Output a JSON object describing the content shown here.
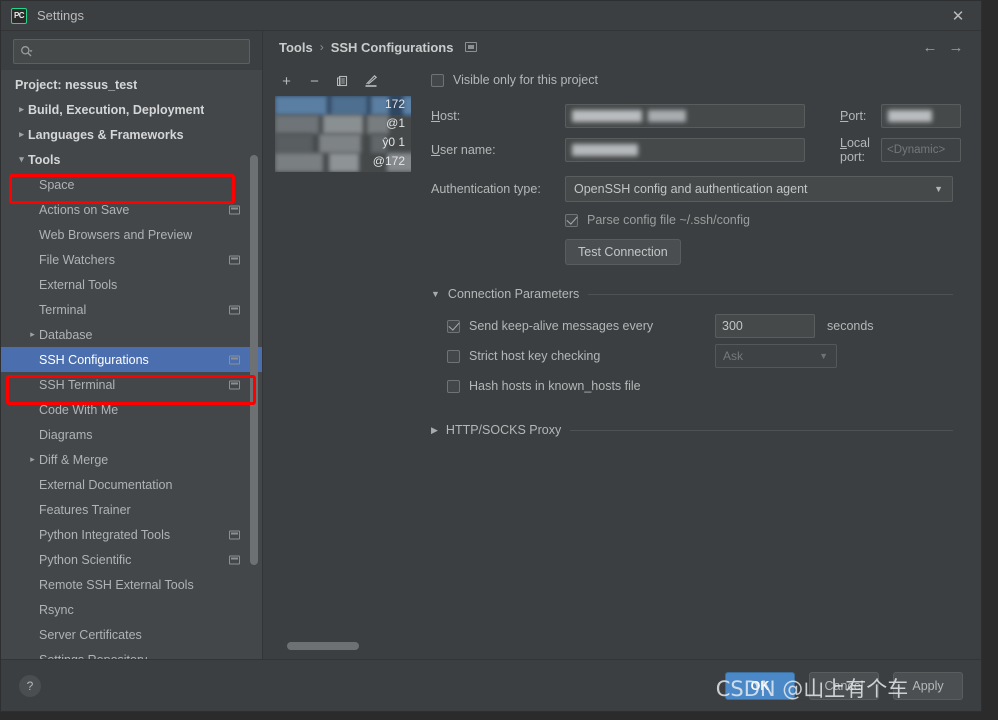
{
  "window": {
    "app_icon_label": "PC",
    "title": "Settings",
    "close_icon": "close-icon"
  },
  "sidebar": {
    "search": {
      "placeholder": "",
      "value": "",
      "icon": "search-icon"
    },
    "items": [
      {
        "label": "Project: nessus_test",
        "arrow": "",
        "bold": true,
        "indent": 1,
        "badge": false,
        "selected": false
      },
      {
        "label": "Build, Execution, Deployment",
        "arrow": "›",
        "bold": true,
        "indent": 1,
        "badge": false,
        "selected": false
      },
      {
        "label": "Languages & Frameworks",
        "arrow": "›",
        "bold": true,
        "indent": 1,
        "badge": false,
        "selected": false
      },
      {
        "label": "Tools",
        "arrow": "⌄",
        "bold": true,
        "indent": 1,
        "badge": false,
        "selected": false
      },
      {
        "label": "Space",
        "arrow": "",
        "bold": false,
        "indent": 2,
        "badge": false,
        "selected": false
      },
      {
        "label": "Actions on Save",
        "arrow": "",
        "bold": false,
        "indent": 2,
        "badge": true,
        "selected": false
      },
      {
        "label": "Web Browsers and Preview",
        "arrow": "",
        "bold": false,
        "indent": 2,
        "badge": false,
        "selected": false
      },
      {
        "label": "File Watchers",
        "arrow": "",
        "bold": false,
        "indent": 2,
        "badge": true,
        "selected": false
      },
      {
        "label": "External Tools",
        "arrow": "",
        "bold": false,
        "indent": 2,
        "badge": false,
        "selected": false
      },
      {
        "label": "Terminal",
        "arrow": "",
        "bold": false,
        "indent": 2,
        "badge": true,
        "selected": false
      },
      {
        "label": "Database",
        "arrow": "›",
        "bold": false,
        "indent": 2,
        "badge": false,
        "selected": false
      },
      {
        "label": "SSH Configurations",
        "arrow": "",
        "bold": false,
        "indent": 2,
        "badge": true,
        "selected": true
      },
      {
        "label": "SSH Terminal",
        "arrow": "",
        "bold": false,
        "indent": 2,
        "badge": true,
        "selected": false
      },
      {
        "label": "Code With Me",
        "arrow": "",
        "bold": false,
        "indent": 2,
        "badge": false,
        "selected": false
      },
      {
        "label": "Diagrams",
        "arrow": "",
        "bold": false,
        "indent": 2,
        "badge": false,
        "selected": false
      },
      {
        "label": "Diff & Merge",
        "arrow": "›",
        "bold": false,
        "indent": 2,
        "badge": false,
        "selected": false
      },
      {
        "label": "External Documentation",
        "arrow": "",
        "bold": false,
        "indent": 2,
        "badge": false,
        "selected": false
      },
      {
        "label": "Features Trainer",
        "arrow": "",
        "bold": false,
        "indent": 2,
        "badge": false,
        "selected": false
      },
      {
        "label": "Python Integrated Tools",
        "arrow": "",
        "bold": false,
        "indent": 2,
        "badge": true,
        "selected": false
      },
      {
        "label": "Python Scientific",
        "arrow": "",
        "bold": false,
        "indent": 2,
        "badge": true,
        "selected": false
      },
      {
        "label": "Remote SSH External Tools",
        "arrow": "",
        "bold": false,
        "indent": 2,
        "badge": false,
        "selected": false
      },
      {
        "label": "Rsync",
        "arrow": "",
        "bold": false,
        "indent": 2,
        "badge": false,
        "selected": false
      },
      {
        "label": "Server Certificates",
        "arrow": "",
        "bold": false,
        "indent": 2,
        "badge": false,
        "selected": false
      },
      {
        "label": "Settings Repository",
        "arrow": "",
        "bold": false,
        "indent": 2,
        "badge": false,
        "selected": false
      }
    ]
  },
  "breadcrumb": {
    "parent": "Tools",
    "separator": "›",
    "current": "SSH Configurations",
    "back_arrow": "←",
    "forward_arrow": "→"
  },
  "list_toolbar": {
    "add": "+",
    "remove": "−",
    "copy": "⎘",
    "edit": "✎"
  },
  "config_list": {
    "rows": [
      {
        "text": "172",
        "selected": true
      },
      {
        "text": "@1",
        "selected": false
      },
      {
        "text": "ŷ0 1",
        "selected": false
      },
      {
        "text": "@172",
        "selected": false
      }
    ]
  },
  "form": {
    "visible_only_label": "Visible only for this project",
    "visible_only_checked": false,
    "host_label": "Host:",
    "host_value": "",
    "port_label": "Port:",
    "port_value": "",
    "username_label": "User name:",
    "username_value": "",
    "local_port_label": "Local port:",
    "local_port_placeholder": "<Dynamic>",
    "auth_type_label": "Authentication type:",
    "auth_type_value": "OpenSSH config and authentication agent",
    "auth_caret": "▼",
    "parse_config_label": "Parse config file ~/.ssh/config",
    "parse_config_checked": true,
    "test_connection_label": "Test Connection"
  },
  "connection_parameters": {
    "section_title": "Connection Parameters",
    "section_caret": "▼",
    "keepalive_label": "Send keep-alive messages every",
    "keepalive_checked": true,
    "keepalive_value": "300",
    "seconds_label": "seconds",
    "strict_host_label": "Strict host key checking",
    "strict_host_checked": false,
    "strict_host_value": "Ask",
    "strict_host_caret": "▼",
    "hash_hosts_label": "Hash hosts in known_hosts file",
    "hash_hosts_checked": false
  },
  "proxy": {
    "section_title": "HTTP/SOCKS Proxy",
    "section_caret": "▶"
  },
  "footer": {
    "help_label": "?",
    "ok_label": "OK",
    "cancel_label": "Cancel",
    "apply_label": "Apply"
  },
  "watermark": {
    "text": "CSDN @山上有个车"
  },
  "colors": {
    "accent_blue": "#4b6eaf",
    "ok_button": "#4a88c7",
    "annotation_red": "#ff0000",
    "panel_bg": "#3c3f41",
    "tree_bg": "#43474a"
  }
}
